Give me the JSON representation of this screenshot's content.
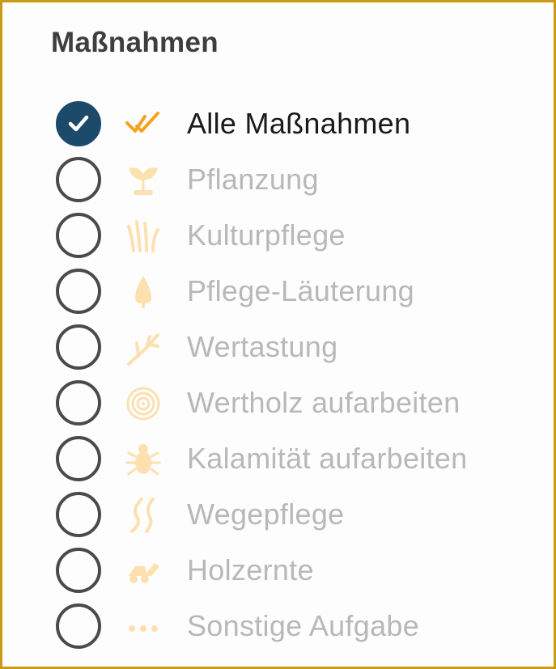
{
  "title": "Maßnahmen",
  "accent_color": "#f4a321",
  "checked_color": "#1c4a6b",
  "items": [
    {
      "label": "Alle Maßnahmen",
      "icon": "double-check-icon",
      "checked": true
    },
    {
      "label": "Pflanzung",
      "icon": "sprout-icon",
      "checked": false
    },
    {
      "label": "Kulturpflege",
      "icon": "grass-icon",
      "checked": false
    },
    {
      "label": "Pflege-Läuterung",
      "icon": "tree-icon",
      "checked": false
    },
    {
      "label": "Wertastung",
      "icon": "branch-icon",
      "checked": false
    },
    {
      "label": "Wertholz aufarbeiten",
      "icon": "tree-rings-icon",
      "checked": false
    },
    {
      "label": "Kalamität aufarbeiten",
      "icon": "beetle-icon",
      "checked": false
    },
    {
      "label": "Wegepflege",
      "icon": "path-icon",
      "checked": false
    },
    {
      "label": "Holzernte",
      "icon": "harvester-icon",
      "checked": false
    },
    {
      "label": "Sonstige Aufgabe",
      "icon": "more-dots-icon",
      "checked": false
    }
  ]
}
